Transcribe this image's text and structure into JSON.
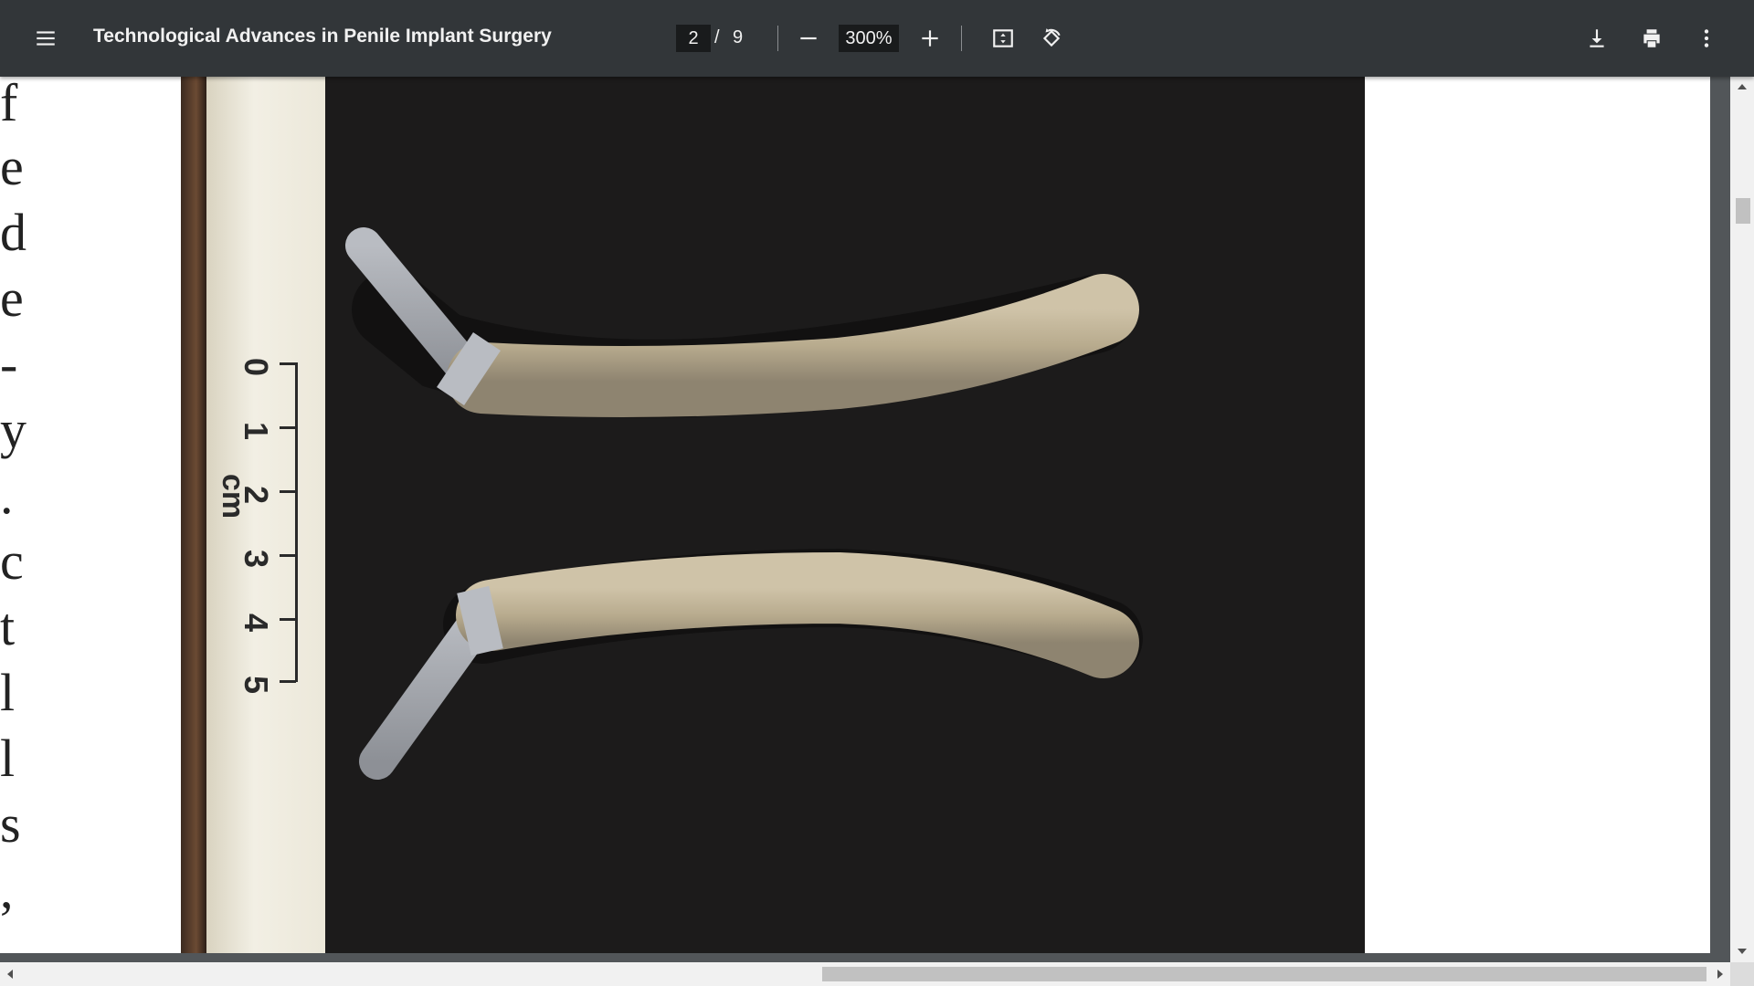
{
  "toolbar": {
    "title": "Technological Advances in Penile Implant Surgery",
    "current_page": "2",
    "page_separator": "/",
    "total_pages": "9",
    "zoom": "300%",
    "icons": [
      "menu-icon",
      "zoom-out-icon",
      "zoom-in-icon",
      "fit-page-icon",
      "rotate-icon",
      "download-icon",
      "print-icon",
      "more-vert-icon"
    ]
  },
  "document": {
    "side_text_glyphs": [
      "f",
      "e",
      "d",
      "e",
      "-",
      "y",
      ".",
      "c",
      "t",
      "l",
      "l",
      "s",
      ","
    ],
    "figure": {
      "ruler_numbers": [
        "0",
        "1",
        "2",
        "3",
        "4",
        "5"
      ],
      "ruler_unit": "cm"
    }
  },
  "colors": {
    "toolbar_bg": "#323639",
    "viewer_bg": "#525659",
    "figure_bg": "#1c1b1b"
  }
}
